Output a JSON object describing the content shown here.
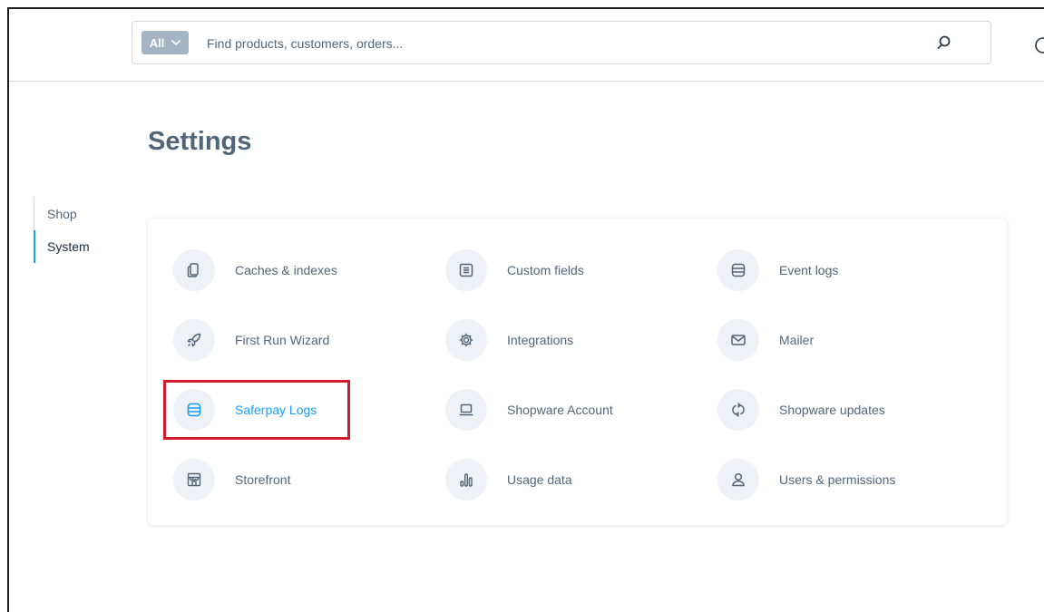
{
  "header": {
    "search": {
      "type_label": "All",
      "placeholder": "Find products, customers, orders..."
    }
  },
  "page": {
    "title": "Settings"
  },
  "side_nav": {
    "items": [
      {
        "label": "Shop",
        "active": false
      },
      {
        "label": "System",
        "active": true
      }
    ]
  },
  "settings": {
    "items": [
      {
        "label": "Caches & indexes",
        "icon": "clipboard-copy-icon"
      },
      {
        "label": "Custom fields",
        "icon": "list-document-icon"
      },
      {
        "label": "Event logs",
        "icon": "database-icon"
      },
      {
        "label": "First Run Wizard",
        "icon": "rocket-icon"
      },
      {
        "label": "Integrations",
        "icon": "gear-icon"
      },
      {
        "label": "Mailer",
        "icon": "envelope-icon"
      },
      {
        "label": "Saferpay Logs",
        "icon": "database-icon",
        "highlighted": true
      },
      {
        "label": "Shopware Account",
        "icon": "laptop-icon"
      },
      {
        "label": "Shopware updates",
        "icon": "sync-icon"
      },
      {
        "label": "Storefront",
        "icon": "storefront-icon"
      },
      {
        "label": "Usage data",
        "icon": "bar-chart-icon"
      },
      {
        "label": "Users & permissions",
        "icon": "user-icon"
      }
    ]
  },
  "colors": {
    "accent": "#189eff",
    "text": "#52667a",
    "highlight_border": "#d11a2a",
    "icon_bg": "#eef1f5"
  }
}
